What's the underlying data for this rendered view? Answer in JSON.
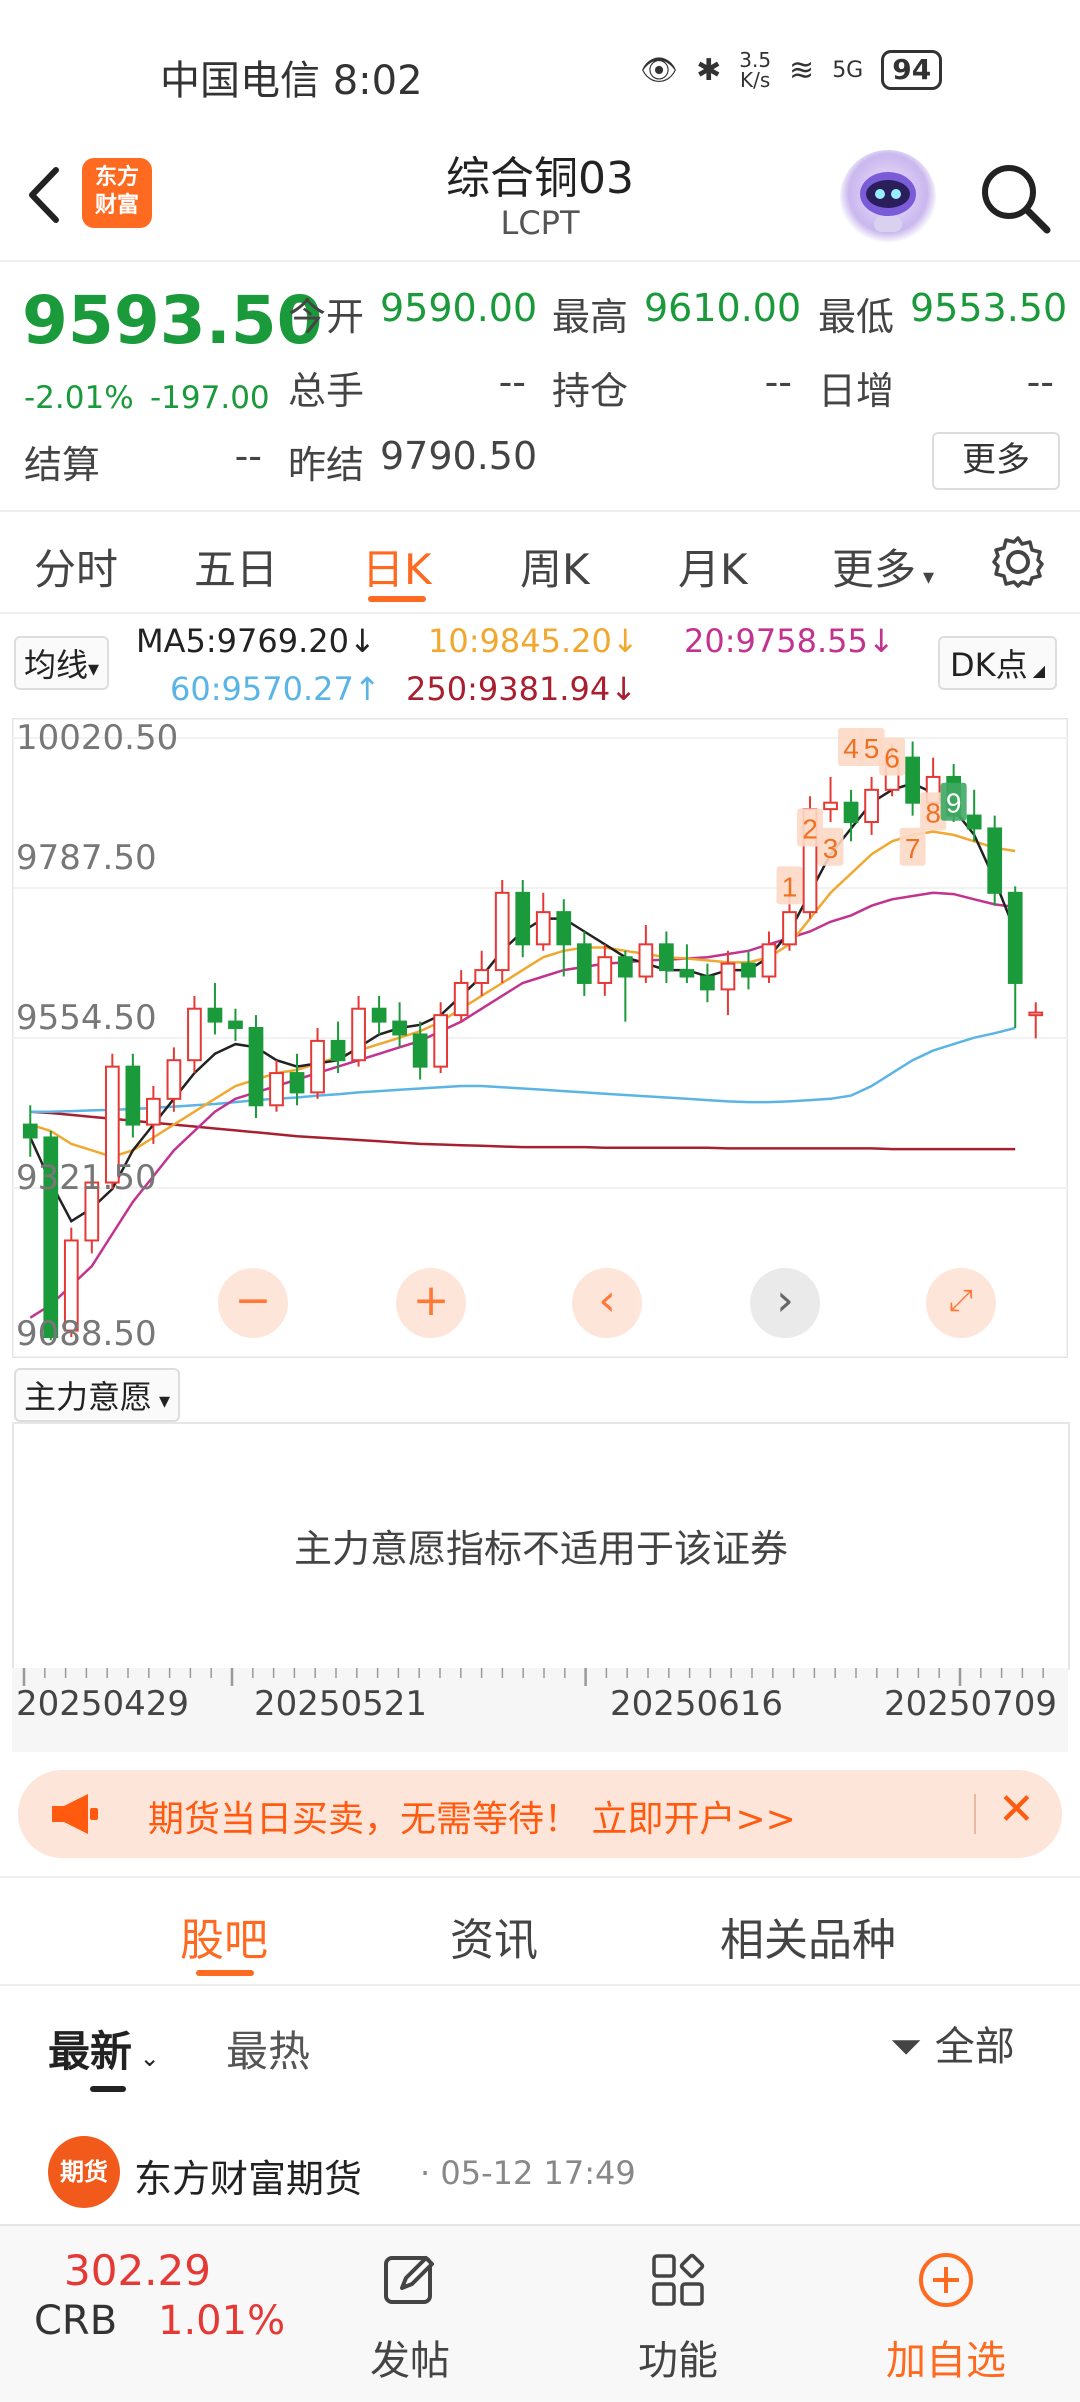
{
  "status_bar": {
    "carrier_time": "中国电信 8:02",
    "net_speed_value": "3.5",
    "net_speed_unit": "K/s",
    "signal_label": "5G",
    "battery": "94"
  },
  "header": {
    "logo_text": "东方\n财富",
    "title": "综合铜03",
    "subtitle": "LCPT"
  },
  "quote": {
    "price": "9593.50",
    "change_pct": "-2.01%",
    "change_abs": "-197.00",
    "open_label": "今开",
    "open_value": "9590.00",
    "high_label": "最高",
    "high_value": "9610.00",
    "low_label": "最低",
    "low_value": "9553.50",
    "volume_label": "总手",
    "volume_value": "--",
    "position_label": "持仓",
    "position_value": "--",
    "daily_inc_label": "日增",
    "daily_inc_value": "--",
    "settle_label": "结算",
    "settle_value": "--",
    "prev_settle_label": "昨结",
    "prev_settle_value": "9790.50",
    "more_button": "更多"
  },
  "tabs": {
    "items": [
      "分时",
      "五日",
      "日K",
      "周K",
      "月K",
      "更多"
    ],
    "active": "日K"
  },
  "ma": {
    "button": "均线",
    "ma5": "MA5:9769.20↓",
    "ma10": "10:9845.20↓",
    "ma20": "20:9758.55↓",
    "ma60": "60:9570.27↑",
    "ma250": "250:9381.94↓",
    "dk_button": "DK点",
    "colors": {
      "ma5": "#222222",
      "ma10": "#f0a830",
      "ma20": "#c2338f",
      "ma60": "#5ab4e6",
      "ma250": "#a82030"
    }
  },
  "chart_data": {
    "type": "candlestick",
    "y_labels": [
      "10020.50",
      "9787.50",
      "9554.50",
      "9321.50",
      "9088.50"
    ],
    "ylim": [
      9088.5,
      10020.5
    ],
    "up_color": "#e53935",
    "down_color": "#1a9a3a",
    "candles": [
      {
        "o": 9420,
        "c": 9400,
        "h": 9450,
        "l": 9370
      },
      {
        "o": 9400,
        "c": 9090,
        "h": 9410,
        "l": 9085
      },
      {
        "o": 9100,
        "c": 9240,
        "h": 9260,
        "l": 9090
      },
      {
        "o": 9240,
        "c": 9330,
        "h": 9350,
        "l": 9220
      },
      {
        "o": 9330,
        "c": 9510,
        "h": 9530,
        "l": 9320
      },
      {
        "o": 9510,
        "c": 9420,
        "h": 9530,
        "l": 9400
      },
      {
        "o": 9420,
        "c": 9460,
        "h": 9480,
        "l": 9390
      },
      {
        "o": 9460,
        "c": 9520,
        "h": 9540,
        "l": 9440
      },
      {
        "o": 9520,
        "c": 9600,
        "h": 9620,
        "l": 9500
      },
      {
        "o": 9600,
        "c": 9580,
        "h": 9640,
        "l": 9560
      },
      {
        "o": 9580,
        "c": 9570,
        "h": 9600,
        "l": 9550
      },
      {
        "o": 9570,
        "c": 9450,
        "h": 9590,
        "l": 9430
      },
      {
        "o": 9450,
        "c": 9500,
        "h": 9520,
        "l": 9440
      },
      {
        "o": 9500,
        "c": 9470,
        "h": 9530,
        "l": 9450
      },
      {
        "o": 9470,
        "c": 9550,
        "h": 9570,
        "l": 9460
      },
      {
        "o": 9550,
        "c": 9520,
        "h": 9580,
        "l": 9500
      },
      {
        "o": 9520,
        "c": 9600,
        "h": 9620,
        "l": 9510
      },
      {
        "o": 9600,
        "c": 9580,
        "h": 9620,
        "l": 9560
      },
      {
        "o": 9580,
        "c": 9560,
        "h": 9610,
        "l": 9540
      },
      {
        "o": 9560,
        "c": 9510,
        "h": 9580,
        "l": 9490
      },
      {
        "o": 9510,
        "c": 9590,
        "h": 9610,
        "l": 9500
      },
      {
        "o": 9590,
        "c": 9640,
        "h": 9660,
        "l": 9580
      },
      {
        "o": 9640,
        "c": 9660,
        "h": 9690,
        "l": 9620
      },
      {
        "o": 9660,
        "c": 9780,
        "h": 9800,
        "l": 9640
      },
      {
        "o": 9780,
        "c": 9700,
        "h": 9800,
        "l": 9680
      },
      {
        "o": 9700,
        "c": 9750,
        "h": 9780,
        "l": 9690
      },
      {
        "o": 9750,
        "c": 9700,
        "h": 9770,
        "l": 9650
      },
      {
        "o": 9700,
        "c": 9640,
        "h": 9720,
        "l": 9620
      },
      {
        "o": 9640,
        "c": 9680,
        "h": 9700,
        "l": 9620
      },
      {
        "o": 9680,
        "c": 9650,
        "h": 9690,
        "l": 9580
      },
      {
        "o": 9650,
        "c": 9700,
        "h": 9730,
        "l": 9640
      },
      {
        "o": 9700,
        "c": 9660,
        "h": 9720,
        "l": 9640
      },
      {
        "o": 9660,
        "c": 9650,
        "h": 9700,
        "l": 9640
      },
      {
        "o": 9650,
        "c": 9630,
        "h": 9670,
        "l": 9610
      },
      {
        "o": 9630,
        "c": 9670,
        "h": 9690,
        "l": 9590
      },
      {
        "o": 9670,
        "c": 9650,
        "h": 9690,
        "l": 9630
      },
      {
        "o": 9650,
        "c": 9700,
        "h": 9720,
        "l": 9640
      },
      {
        "o": 9700,
        "c": 9750,
        "h": 9780,
        "l": 9690
      },
      {
        "o": 9750,
        "c": 9910,
        "h": 9930,
        "l": 9740
      },
      {
        "o": 9910,
        "c": 9920,
        "h": 9960,
        "l": 9890
      },
      {
        "o": 9920,
        "c": 9890,
        "h": 9940,
        "l": 9860
      },
      {
        "o": 9890,
        "c": 9940,
        "h": 9960,
        "l": 9870
      },
      {
        "o": 9940,
        "c": 9990,
        "h": 10010,
        "l": 9930
      },
      {
        "o": 9990,
        "c": 9920,
        "h": 10015,
        "l": 9900
      },
      {
        "o": 9920,
        "c": 9960,
        "h": 9990,
        "l": 9910
      },
      {
        "o": 9960,
        "c": 9900,
        "h": 9980,
        "l": 9890
      },
      {
        "o": 9900,
        "c": 9880,
        "h": 9940,
        "l": 9860
      },
      {
        "o": 9880,
        "c": 9780,
        "h": 9900,
        "l": 9760
      },
      {
        "o": 9780,
        "c": 9640,
        "h": 9790,
        "l": 9570
      },
      {
        "o": 9590,
        "c": 9594,
        "h": 9610,
        "l": 9554
      }
    ],
    "ma5": [
      9400,
      9330,
      9270,
      9290,
      9320,
      9380,
      9420,
      9460,
      9500,
      9530,
      9545,
      9540,
      9520,
      9510,
      9515,
      9520,
      9540,
      9560,
      9570,
      9575,
      9590,
      9620,
      9650,
      9690,
      9720,
      9740,
      9740,
      9720,
      9700,
      9680,
      9670,
      9660,
      9660,
      9650,
      9660,
      9660,
      9680,
      9720,
      9780,
      9840,
      9880,
      9920,
      9940,
      9950,
      9935,
      9910,
      9870,
      9800,
      9720
    ],
    "ma10": [
      9420,
      9410,
      9390,
      9380,
      9370,
      9380,
      9400,
      9420,
      9440,
      9460,
      9480,
      9490,
      9500,
      9505,
      9515,
      9525,
      9535,
      9545,
      9555,
      9565,
      9580,
      9600,
      9620,
      9640,
      9660,
      9680,
      9690,
      9695,
      9695,
      9690,
      9685,
      9680,
      9678,
      9675,
      9672,
      9672,
      9680,
      9700,
      9740,
      9780,
      9810,
      9840,
      9860,
      9870,
      9875,
      9870,
      9860,
      9850,
      9845
    ],
    "ma20": [
      9120,
      9140,
      9170,
      9200,
      9250,
      9300,
      9340,
      9380,
      9410,
      9440,
      9460,
      9470,
      9480,
      9490,
      9500,
      9510,
      9520,
      9530,
      9540,
      9550,
      9565,
      9580,
      9600,
      9620,
      9640,
      9650,
      9660,
      9665,
      9670,
      9672,
      9675,
      9676,
      9678,
      9680,
      9685,
      9690,
      9700,
      9710,
      9720,
      9735,
      9745,
      9760,
      9770,
      9775,
      9780,
      9778,
      9770,
      9762,
      9758
    ],
    "ma60": [
      9440,
      9440,
      9441,
      9442,
      9443,
      9444,
      9446,
      9448,
      9450,
      9452,
      9455,
      9458,
      9460,
      9462,
      9465,
      9467,
      9470,
      9472,
      9474,
      9476,
      9478,
      9480,
      9480,
      9478,
      9476,
      9474,
      9472,
      9470,
      9468,
      9466,
      9464,
      9462,
      9460,
      9458,
      9456,
      9455,
      9455,
      9456,
      9458,
      9460,
      9465,
      9480,
      9500,
      9520,
      9535,
      9545,
      9555,
      9562,
      9570
    ],
    "ma250": [
      9440,
      9438,
      9435,
      9432,
      9429,
      9426,
      9423,
      9420,
      9417,
      9414,
      9411,
      9408,
      9405,
      9402,
      9400,
      9398,
      9396,
      9394,
      9392,
      9390,
      9389,
      9388,
      9387,
      9386,
      9385,
      9385,
      9385,
      9385,
      9384,
      9384,
      9384,
      9384,
      9384,
      9384,
      9383,
      9383,
      9383,
      9383,
      9383,
      9383,
      9383,
      9383,
      9382,
      9382,
      9382,
      9382,
      9382,
      9382,
      9382
    ],
    "dk_marks": [
      {
        "label": "1",
        "candle": 37,
        "price": 9790
      },
      {
        "label": "2",
        "candle": 38,
        "price": 9880
      },
      {
        "label": "3",
        "candle": 39,
        "price": 9850
      },
      {
        "label": "4",
        "candle": 40,
        "price": 10005
      },
      {
        "label": "5",
        "candle": 41,
        "price": 10005
      },
      {
        "label": "6",
        "candle": 42,
        "price": 9990
      },
      {
        "label": "7",
        "candle": 43,
        "price": 9850
      },
      {
        "label": "8",
        "candle": 44,
        "price": 9905
      },
      {
        "label": "9",
        "candle": 45,
        "price": 9920
      }
    ],
    "x_labels": [
      "20250429",
      "20250521",
      "20250616",
      "20250709"
    ]
  },
  "chart_buttons": {
    "minus": "−",
    "plus": "+",
    "left": "‹",
    "right": "›"
  },
  "indicator": {
    "button": "主力意愿",
    "message": "主力意愿指标不适用于该证券"
  },
  "banner": {
    "text": "期货当日买卖，无需等待！ 立即开户>>",
    "close": "✕"
  },
  "section_tabs": {
    "items": [
      "股吧",
      "资讯",
      "相关品种"
    ],
    "active": "股吧"
  },
  "sort": {
    "latest": "最新",
    "hot": "最热",
    "filter": "全部"
  },
  "post": {
    "avatar_text": "期货",
    "author": "东方财富期货",
    "time": "· 05-12 17:49"
  },
  "bottom": {
    "crb_value": "302.29",
    "crb_name": "CRB",
    "crb_pct": "1.01%",
    "post_label": "发帖",
    "func_label": "功能",
    "watch_label": "加自选"
  }
}
